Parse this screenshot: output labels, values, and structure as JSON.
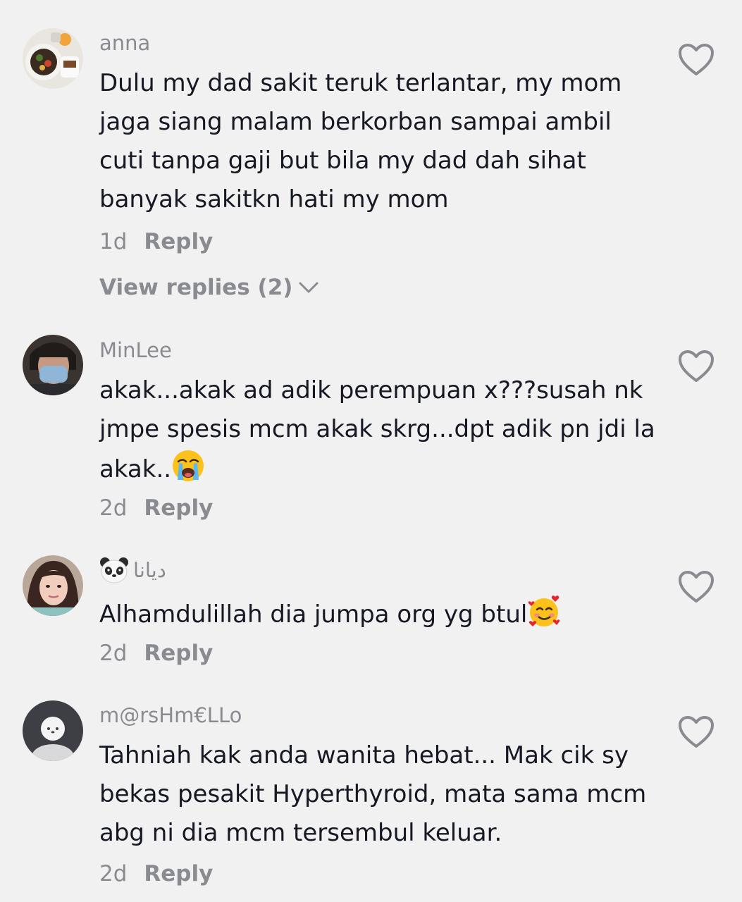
{
  "comments": [
    {
      "username": "anna",
      "text": "Dulu my dad sakit teruk terlantar, my mom jaga siang malam berkorban sampai ambil cuti tanpa gaji but bila my dad dah sihat banyak sakitkn hati my mom",
      "time": "1d",
      "reply_label": "Reply",
      "view_replies": "View replies (2)",
      "avatar": "food-plate-avatar"
    },
    {
      "username": "MinLee",
      "text": "akak...akak ad adik perempuan x???susah nk jmpe spesis mcm akak skrg...dpt adik pn jdi la akak..",
      "emoji": "loudly-crying-face",
      "time": "2d",
      "reply_label": "Reply",
      "avatar": "masked-person-avatar"
    },
    {
      "username": "ديانا",
      "username_emoji": "panda-face",
      "text": "Alhamdulillah dia jumpa org yg btul",
      "emoji": "smiling-face-with-hearts",
      "time": "2d",
      "reply_label": "Reply",
      "avatar": "woman-portrait-avatar"
    },
    {
      "username": "m@rsHm€LLo",
      "text": "Tahniah kak anda wanita hebat... Mak cik sy bekas pesakit Hyperthyroid, mata sama mcm abg ni dia mcm tersembul keluar.",
      "time": "2d",
      "reply_label": "Reply",
      "avatar": "default-ghost-avatar"
    }
  ],
  "icons": {
    "like": "heart-outline-icon",
    "expand": "chevron-down-icon"
  },
  "colors": {
    "background": "#f1f1f2",
    "text": "#161823",
    "secondary": "#8a8b91"
  }
}
